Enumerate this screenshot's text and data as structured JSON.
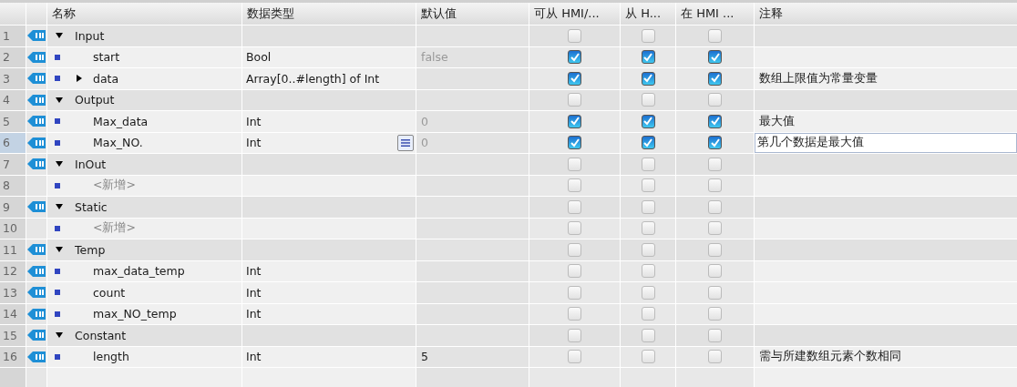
{
  "columns": [
    "名称",
    "数据类型",
    "默认值",
    "可从 HMI/...",
    "从 H...",
    "在 HMI ...",
    "注释"
  ],
  "sections": [
    {
      "num": "1",
      "name": "Input",
      "expanded": true,
      "selected": false,
      "hmi": [
        {
          "checked": false
        },
        {
          "checked": false
        },
        {
          "checked": false
        }
      ],
      "children": [
        {
          "kind": "member",
          "num": "2",
          "name": "start",
          "type": "Bool",
          "default": "false",
          "default_dimmed": true,
          "selected": false,
          "hmi": [
            {
              "checked": true
            },
            {
              "checked": true
            },
            {
              "checked": true
            }
          ]
        },
        {
          "kind": "member",
          "num": "3",
          "name": "data",
          "expanded": false,
          "type": "Array[0..#length] of Int",
          "selected": false,
          "hmi": [
            {
              "checked": true
            },
            {
              "checked": true
            },
            {
              "checked": true
            }
          ],
          "comment": "数组上限值为常量变量"
        }
      ]
    },
    {
      "num": "4",
      "name": "Output",
      "expanded": true,
      "selected": false,
      "hmi": [
        {
          "checked": false
        },
        {
          "checked": false
        },
        {
          "checked": false
        }
      ],
      "children": [
        {
          "kind": "member",
          "num": "5",
          "name": "Max_data",
          "type": "Int",
          "default": "0",
          "default_dimmed": true,
          "selected": false,
          "hmi": [
            {
              "checked": true
            },
            {
              "checked": true
            },
            {
              "checked": true
            }
          ],
          "comment": "最大值"
        },
        {
          "kind": "member",
          "num": "6",
          "name": "Max_NO.",
          "type": "Int",
          "default": "0",
          "default_dimmed": true,
          "selected": true,
          "hmi": [
            {
              "checked": true
            },
            {
              "checked": true
            },
            {
              "checked": true
            }
          ],
          "comment": "第几个数据是最大值"
        }
      ]
    },
    {
      "num": "7",
      "name": "InOut",
      "expanded": true,
      "selected": false,
      "hmi": [
        {
          "checked": false
        },
        {
          "checked": false
        },
        {
          "checked": false
        }
      ],
      "children": [
        {
          "kind": "add",
          "num": "8",
          "name": "<新增>",
          "selected": false,
          "hmi": [
            {
              "checked": false
            },
            {
              "checked": false
            },
            {
              "checked": false
            }
          ]
        }
      ]
    },
    {
      "num": "9",
      "name": "Static",
      "expanded": true,
      "selected": false,
      "hmi": [
        {
          "checked": false
        },
        {
          "checked": false
        },
        {
          "checked": false
        }
      ],
      "children": [
        {
          "kind": "add",
          "num": "10",
          "name": "<新增>",
          "selected": false,
          "hmi": [
            {
              "checked": false
            },
            {
              "checked": false
            },
            {
              "checked": false
            }
          ]
        }
      ]
    },
    {
      "num": "11",
      "name": "Temp",
      "expanded": true,
      "selected": false,
      "hmi": [
        {
          "checked": false
        },
        {
          "checked": false
        },
        {
          "checked": false
        }
      ],
      "children": [
        {
          "kind": "member",
          "num": "12",
          "name": "max_data_temp",
          "type": "Int",
          "selected": false,
          "hmi": [
            {
              "checked": false
            },
            {
              "checked": false
            },
            {
              "checked": false
            }
          ]
        },
        {
          "kind": "member",
          "num": "13",
          "name": "count",
          "type": "Int",
          "selected": false,
          "hmi": [
            {
              "checked": false
            },
            {
              "checked": false
            },
            {
              "checked": false
            }
          ]
        },
        {
          "kind": "member",
          "num": "14",
          "name": "max_NO_temp",
          "type": "Int",
          "selected": false,
          "hmi": [
            {
              "checked": false
            },
            {
              "checked": false
            },
            {
              "checked": false
            }
          ]
        }
      ]
    },
    {
      "num": "15",
      "name": "Constant",
      "expanded": true,
      "selected": false,
      "hmi": [
        {
          "checked": false
        },
        {
          "checked": false
        },
        {
          "checked": false
        }
      ],
      "children": [
        {
          "kind": "member",
          "num": "16",
          "name": "length",
          "type": "Int",
          "default": "5",
          "default_dimmed": false,
          "selected": false,
          "hmi": [
            {
              "checked": false
            },
            {
              "checked": false
            },
            {
              "checked": false
            }
          ],
          "comment": "需与所建数组元素个数相同"
        }
      ]
    }
  ]
}
